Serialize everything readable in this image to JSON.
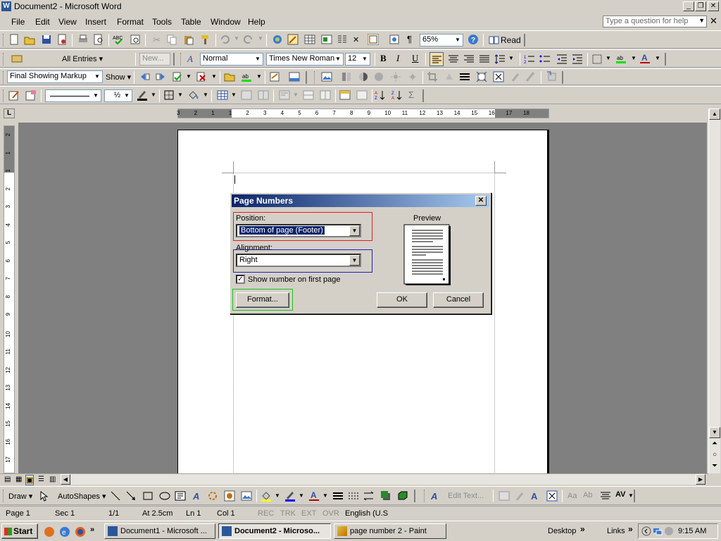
{
  "window": {
    "title": "Document2 - Microsoft Word"
  },
  "menu": [
    "File",
    "Edit",
    "View",
    "Insert",
    "Format",
    "Tools",
    "Table",
    "Window",
    "Help"
  ],
  "help": {
    "placeholder": "Type a question for help"
  },
  "toolbar_standard": {
    "zoom": "65%",
    "read_label": "Read"
  },
  "toolbar_mail": {
    "entries": "All Entries ▾",
    "new_label": "New..."
  },
  "toolbar_formatting": {
    "style": "Normal",
    "font": "Times New Roman",
    "size": "12",
    "bold": "B",
    "italic": "I",
    "underline": "U"
  },
  "toolbar_review": {
    "markup": "Final Showing Markup",
    "show_label": "Show ▾"
  },
  "toolbar_tables": {
    "line_weight": "½"
  },
  "ruler": {
    "corner": "L",
    "h_ticks": [
      "3",
      "2",
      "1",
      "1",
      "2",
      "3",
      "4",
      "5",
      "6",
      "7",
      "8",
      "9",
      "10",
      "11",
      "12",
      "13",
      "14",
      "15",
      "16",
      "17",
      "18"
    ],
    "v_ticks": [
      "2",
      "1",
      "1",
      "2",
      "3",
      "4",
      "5",
      "6",
      "7",
      "8",
      "9",
      "10",
      "11",
      "12",
      "13",
      "14",
      "15",
      "16",
      "17"
    ]
  },
  "dialog": {
    "title": "Page Numbers",
    "position_label": "Position:",
    "position_value": "Bottom of page (Footer)",
    "alignment_label": "Alignment:",
    "alignment_value": "Right",
    "show_first_label": "Show number on first page",
    "preview_label": "Preview",
    "format_label": "Format...",
    "ok_label": "OK",
    "cancel_label": "Cancel",
    "colors": {
      "position_box": "#e02020",
      "alignment_box": "#2020c0",
      "format_box": "#20c020"
    }
  },
  "drawing": {
    "draw_label": "Draw ▾",
    "autoshapes_label": "AutoShapes ▾",
    "edit_text_label": "Edit Text..."
  },
  "status": {
    "page": "Page  1",
    "sec": "Sec  1",
    "pages": "1/1",
    "at": "At  2.5cm",
    "ln": "Ln  1",
    "col": "Col  1",
    "rec": "REC",
    "trk": "TRK",
    "ext": "EXT",
    "ovr": "OVR",
    "lang": "English (U.S"
  },
  "taskbar": {
    "start": "Start",
    "tasks": [
      "Document1 - Microsoft ...",
      "Document2 - Microso...",
      "page number 2 - Paint"
    ],
    "desktop": "Desktop",
    "links": "Links",
    "time": "9:15 AM"
  }
}
